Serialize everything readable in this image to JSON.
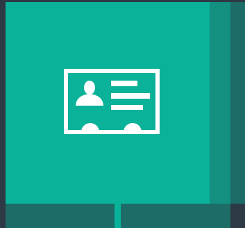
{
  "tiles": {
    "main": {
      "icon": "id-card-icon",
      "color": "#0ab29a"
    },
    "side_inner": {
      "color": "#13907f"
    },
    "side_outer": {
      "color": "#1d6c68"
    },
    "bottom_left": {
      "color": "#1d6c68"
    },
    "bottom_right": {
      "color": "#1d6c68"
    }
  },
  "colors": {
    "background": "#2d3a45",
    "icon": "#ffffff"
  }
}
